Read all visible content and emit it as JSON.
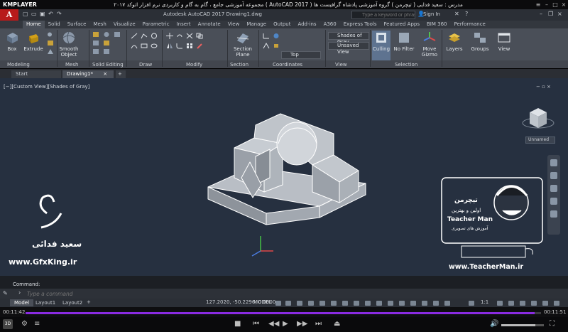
{
  "player": {
    "logo": "KMPLAYER",
    "title": "مجموعه آموزشی جامع ، گام به گام و کاربردی نرم افزار   اتوکد ۲۰۱۷ ( AutoCAD 2017 )   مدرس : سعید فدایی ( تیچرمن ) گروه آموزشی پادشاه گرافیست ها",
    "current_time": "00:11:42",
    "total_time": "00:11:51",
    "progress": 0.987,
    "volume": 0.8,
    "badge": "3D"
  },
  "app": {
    "logo": "A",
    "title": "Autodesk AutoCAD 2017    Drawing1.dwg",
    "search_placeholder": "Type a keyword or phrase",
    "sign_in": "Sign In"
  },
  "ribbon_tabs": [
    "Home",
    "Solid",
    "Surface",
    "Mesh",
    "Visualize",
    "Parametric",
    "Insert",
    "Annotate",
    "View",
    "Manage",
    "Output",
    "Add-ins",
    "A360",
    "Express Tools",
    "Featured Apps",
    "BIM 360",
    "Performance"
  ],
  "ribbon": {
    "box": "Box",
    "extrude": "Extrude",
    "smooth_object": "Smooth\nObject",
    "section_plane": "Section\nPlane",
    "culling": "Culling",
    "no_filter": "No Filter",
    "move_gizmo": "Move\nGizmo",
    "layers": "Layers",
    "groups": "Groups",
    "view": "View",
    "visual_style": "Shades of Gray",
    "saved_view": "Unsaved View",
    "ucs_view": "Top",
    "panels": [
      "Modeling",
      "Mesh",
      "Solid Editing",
      "Draw",
      "Modify",
      "Section",
      "Coordinates",
      "View",
      "Selection"
    ]
  },
  "file_tabs": [
    "Start",
    "Drawing1*"
  ],
  "viewport": {
    "label": "[−][Custom View][Shades of Gray]",
    "ctrls": "− ▫ ×",
    "unnamed": "Unnamed"
  },
  "watermarks": {
    "left_name": "سعید فدائی",
    "left_url": "www.GfxKing.ir",
    "right_url": "www.TeacherMan.ir",
    "brand_fa": "تیچرمن",
    "brand_sub": "اولین و بهترین",
    "brand_en": "Teacher Man",
    "brand_tag": "آموزش های تصویری"
  },
  "command": {
    "history": "Command:",
    "placeholder": "Type a command"
  },
  "layout_tabs": [
    "Model",
    "Layout1",
    "Layout2"
  ],
  "status": {
    "coords": "127.2020, -50.2296, 0.0000",
    "model": "MODEL",
    "zoom": "1:1"
  },
  "colors": {
    "viewport_bg": "#263040",
    "ribbon_bg": "#4a4f58",
    "solid_face": "#b8bdc4",
    "solid_edge": "#ffffff",
    "accent": "#b81a1a"
  }
}
